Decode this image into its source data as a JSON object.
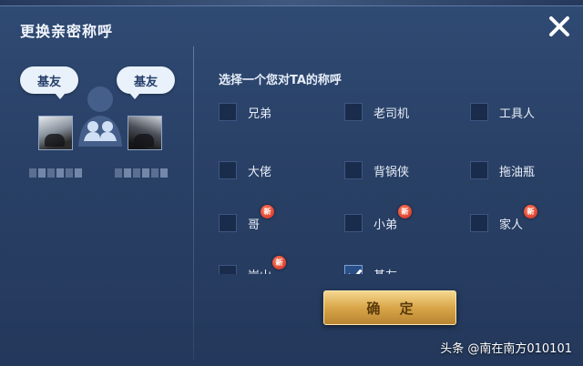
{
  "dialog": {
    "title": "更换亲密称呼",
    "close_icon": "close-icon"
  },
  "relationship": {
    "left_bubble": "基友",
    "right_bubble": "基友",
    "center_icon": "intimacy-pair-icon"
  },
  "selection": {
    "prompt": "选择一个您对TA的称呼",
    "options": [
      {
        "label": "兄弟",
        "checked": false,
        "new": false
      },
      {
        "label": "老司机",
        "checked": false,
        "new": false
      },
      {
        "label": "工具人",
        "checked": false,
        "new": false
      },
      {
        "label": "大佬",
        "checked": false,
        "new": false
      },
      {
        "label": "背锅侠",
        "checked": false,
        "new": false
      },
      {
        "label": "拖油瓶",
        "checked": false,
        "new": false
      },
      {
        "label": "哥",
        "checked": false,
        "new": true
      },
      {
        "label": "小弟",
        "checked": false,
        "new": true
      },
      {
        "label": "家人",
        "checked": false,
        "new": true
      },
      {
        "label": "岩山",
        "checked": false,
        "new": true
      },
      {
        "label": "基友",
        "checked": true,
        "new": false
      }
    ],
    "new_badge": "新"
  },
  "actions": {
    "confirm_label": "确 定"
  },
  "watermark": "头条 @南在南方010101",
  "colors": {
    "panel": "#2a4167",
    "confirm_gold": "#d9a649",
    "badge_red": "#d12a1e"
  }
}
